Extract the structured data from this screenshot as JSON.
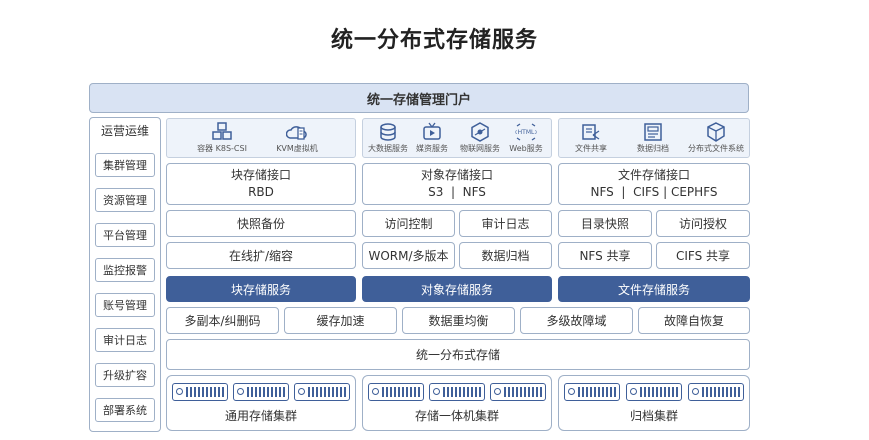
{
  "title": "统一分布式存储服务",
  "portal": "统一存储管理门户",
  "ops": {
    "title": "运营运维",
    "items": [
      "集群管理",
      "资源管理",
      "平台管理",
      "监控报警",
      "账号管理",
      "审计日志",
      "升级扩容",
      "部署系统"
    ]
  },
  "services": {
    "block": [
      "容器 K8S-CSI",
      "KVM虚拟机"
    ],
    "object": [
      "大数据服务",
      "媒资服务",
      "物联网服务",
      "Web服务"
    ],
    "file": [
      "文件共享",
      "数据归档",
      "分布式文件系统"
    ]
  },
  "interfaces": {
    "block": {
      "title": "块存储接口",
      "sub": "RBD"
    },
    "object": {
      "title": "对象存储接口",
      "sub": "S3  |  NFS"
    },
    "file": {
      "title": "文件存储接口",
      "sub": "NFS  |  CIFS | CEPHFS"
    }
  },
  "features_row1": {
    "block": "快照备份",
    "object": [
      "访问控制",
      "审计日志"
    ],
    "file": [
      "目录快照",
      "访问授权"
    ]
  },
  "features_row2": {
    "block": "在线扩/缩容",
    "object": [
      "WORM/多版本",
      "数据归档"
    ],
    "file": [
      "NFS 共享",
      "CIFS 共享"
    ]
  },
  "service_bars": [
    "块存储服务",
    "对象存储服务",
    "文件存储服务"
  ],
  "capabilities": [
    "多副本/纠删码",
    "缓存加速",
    "数据重均衡",
    "多级故障域",
    "故障自恢复"
  ],
  "unified": "统一分布式存储",
  "clusters": [
    "通用存储集群",
    "存储一体机集群",
    "归档集群"
  ],
  "colors": {
    "accent": "#3f5f99",
    "portal_bg": "#d9e3f3",
    "border": "#9fb0c7"
  }
}
